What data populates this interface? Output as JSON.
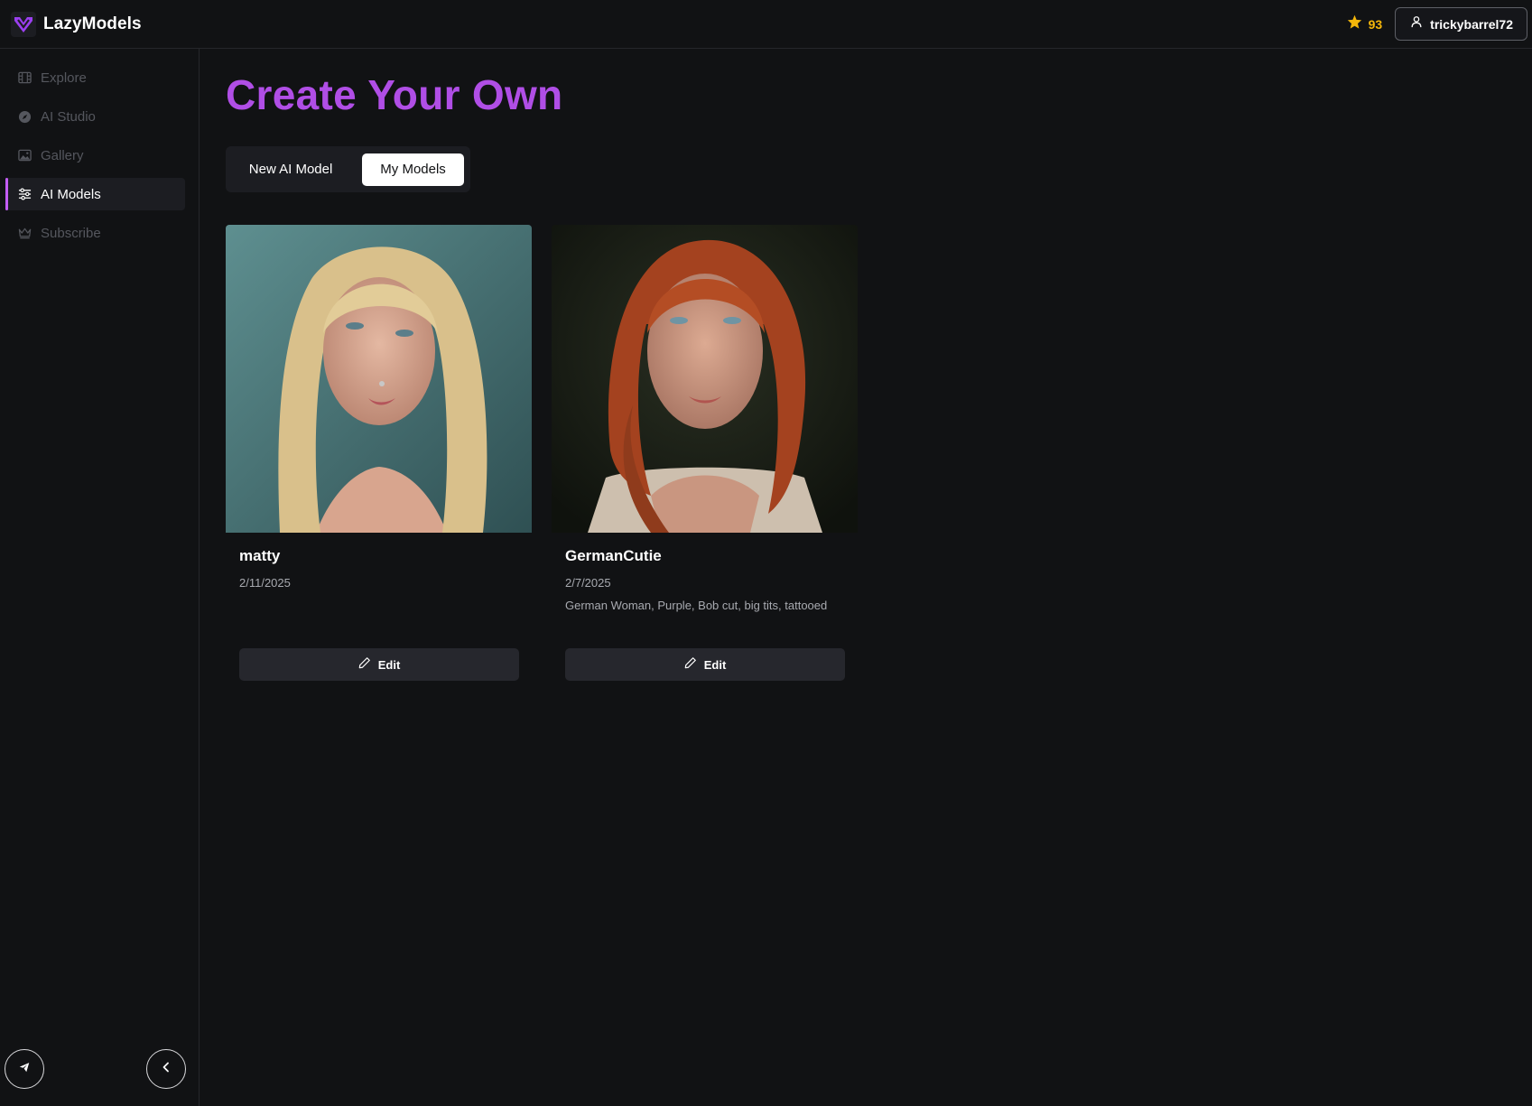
{
  "header": {
    "brand_name": "LazyModels",
    "credits": "93",
    "username": "trickybarrel72"
  },
  "sidebar": {
    "items": [
      {
        "label": "Explore",
        "icon": "film-icon",
        "active": false
      },
      {
        "label": "AI Studio",
        "icon": "compass-icon",
        "active": false
      },
      {
        "label": "Gallery",
        "icon": "image-icon",
        "active": false
      },
      {
        "label": "AI Models",
        "icon": "sliders-icon",
        "active": true
      },
      {
        "label": "Subscribe",
        "icon": "crown-icon",
        "active": false
      }
    ],
    "bottom_left_icon": "telegram-icon",
    "bottom_right_icon": "chevron-left-icon"
  },
  "main": {
    "title": "Create Your Own",
    "tabs": [
      {
        "label": "New AI Model",
        "selected": false
      },
      {
        "label": "My Models",
        "selected": true
      }
    ],
    "cards": [
      {
        "name": "matty",
        "date": "2/11/2025",
        "description": "",
        "edit_label": "Edit"
      },
      {
        "name": "GermanCutie",
        "date": "2/7/2025",
        "description": "German Woman, Purple, Bob cut, big tits, tattooed",
        "edit_label": "Edit"
      }
    ]
  },
  "colors": {
    "accent": "#b04ee6",
    "credits": "#f5b70a",
    "background": "#111214"
  }
}
